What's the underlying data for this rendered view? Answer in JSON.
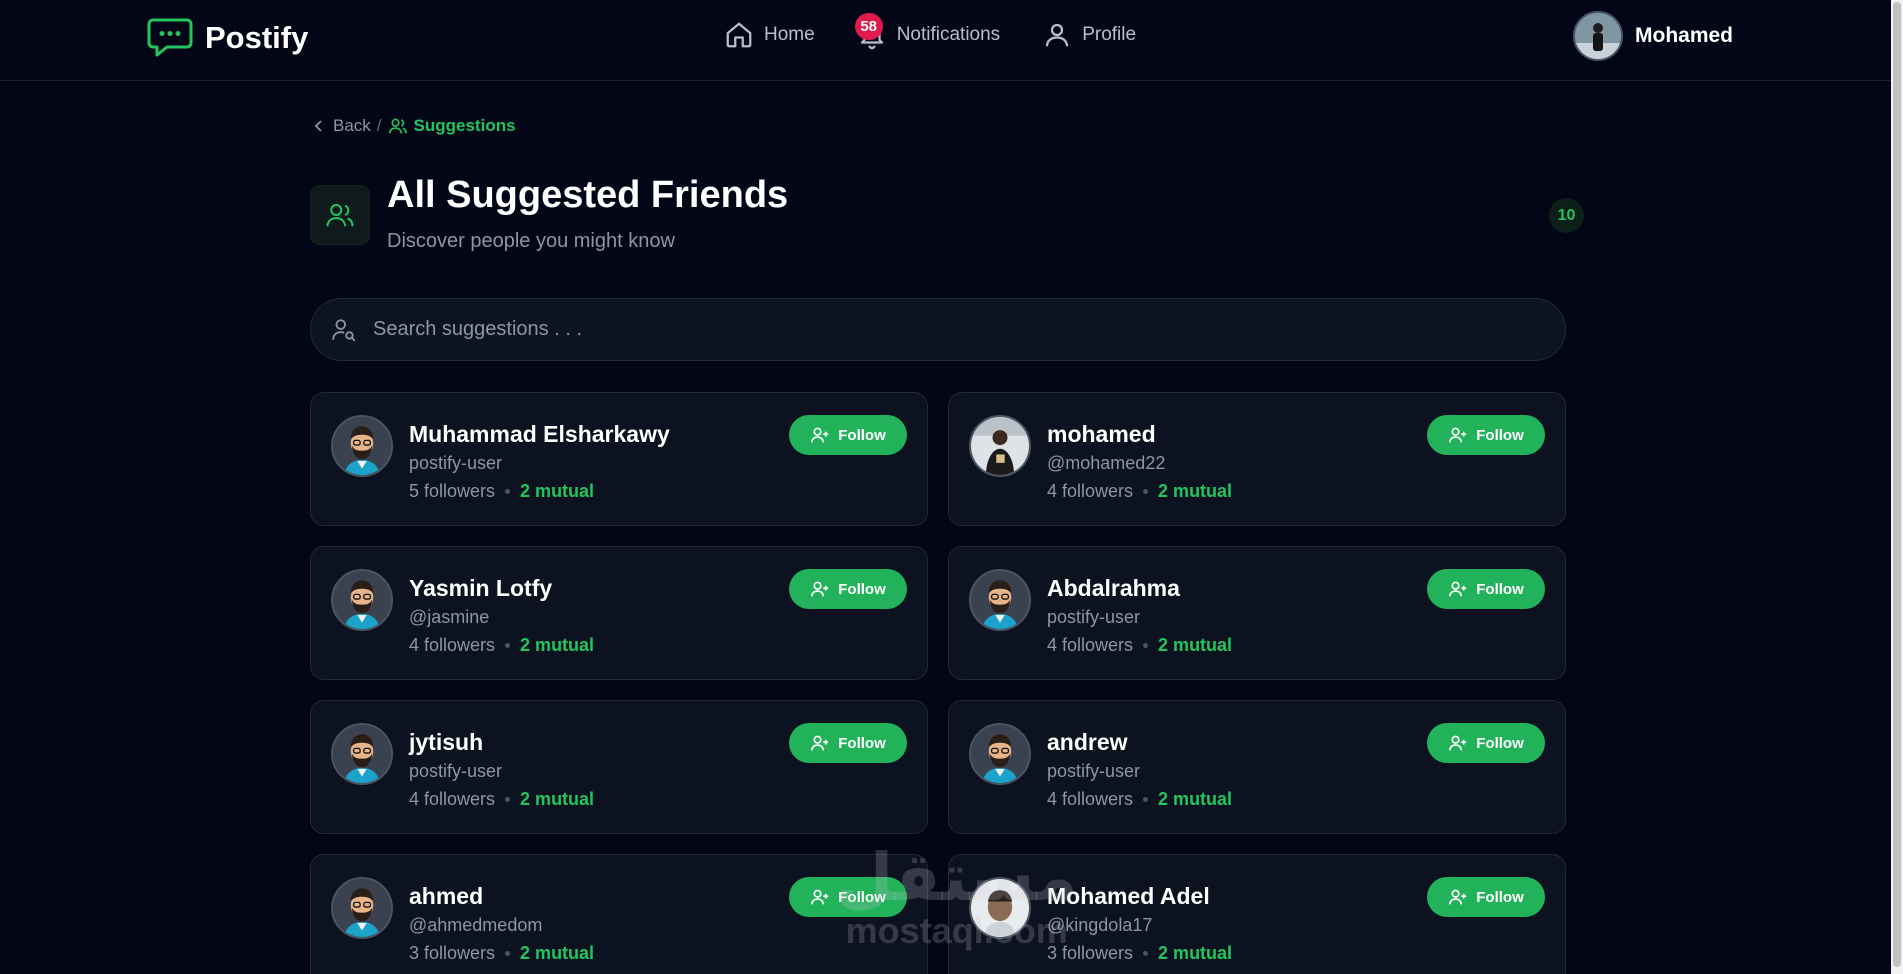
{
  "brand": {
    "name": "Postify",
    "icon": "chat-bubble-icon",
    "accent": "#22c55e"
  },
  "nav": {
    "home": {
      "label": "Home",
      "icon": "home-icon"
    },
    "notifications": {
      "label": "Notifications",
      "icon": "bell-icon",
      "badge": "58"
    },
    "profile": {
      "label": "Profile",
      "icon": "user-icon"
    }
  },
  "user": {
    "name": "Mohamed"
  },
  "breadcrumb": {
    "back": "Back",
    "separator": "/",
    "current": "Suggestions"
  },
  "page": {
    "title": "All Suggested Friends",
    "subtitle": "Discover people you might know",
    "count": "10"
  },
  "search": {
    "placeholder": "Search suggestions . . ."
  },
  "follow_label": "Follow",
  "suggestions": [
    {
      "name": "Muhammad Elsharkawy",
      "handle": "postify-user",
      "followers": "5 followers",
      "mutual": "2 mutual",
      "avatar": "default"
    },
    {
      "name": "mohamed",
      "handle": "@mohamed22",
      "followers": "4 followers",
      "mutual": "2 mutual",
      "avatar": "photo"
    },
    {
      "name": "Yasmin Lotfy",
      "handle": "@jasmine",
      "followers": "4 followers",
      "mutual": "2 mutual",
      "avatar": "default"
    },
    {
      "name": "Abdalrahma",
      "handle": "postify-user",
      "followers": "4 followers",
      "mutual": "2 mutual",
      "avatar": "default"
    },
    {
      "name": "jytisuh",
      "handle": "postify-user",
      "followers": "4 followers",
      "mutual": "2 mutual",
      "avatar": "default"
    },
    {
      "name": "andrew",
      "handle": "postify-user",
      "followers": "4 followers",
      "mutual": "2 mutual",
      "avatar": "default"
    },
    {
      "name": "ahmed",
      "handle": "@ahmedmedom",
      "followers": "3 followers",
      "mutual": "2 mutual",
      "avatar": "default"
    },
    {
      "name": "Mohamed Adel",
      "handle": "@kingdola17",
      "followers": "3 followers",
      "mutual": "2 mutual",
      "avatar": "photo-light"
    }
  ],
  "watermark": {
    "arabic": "مستقل",
    "latin": "mostaql.com"
  }
}
